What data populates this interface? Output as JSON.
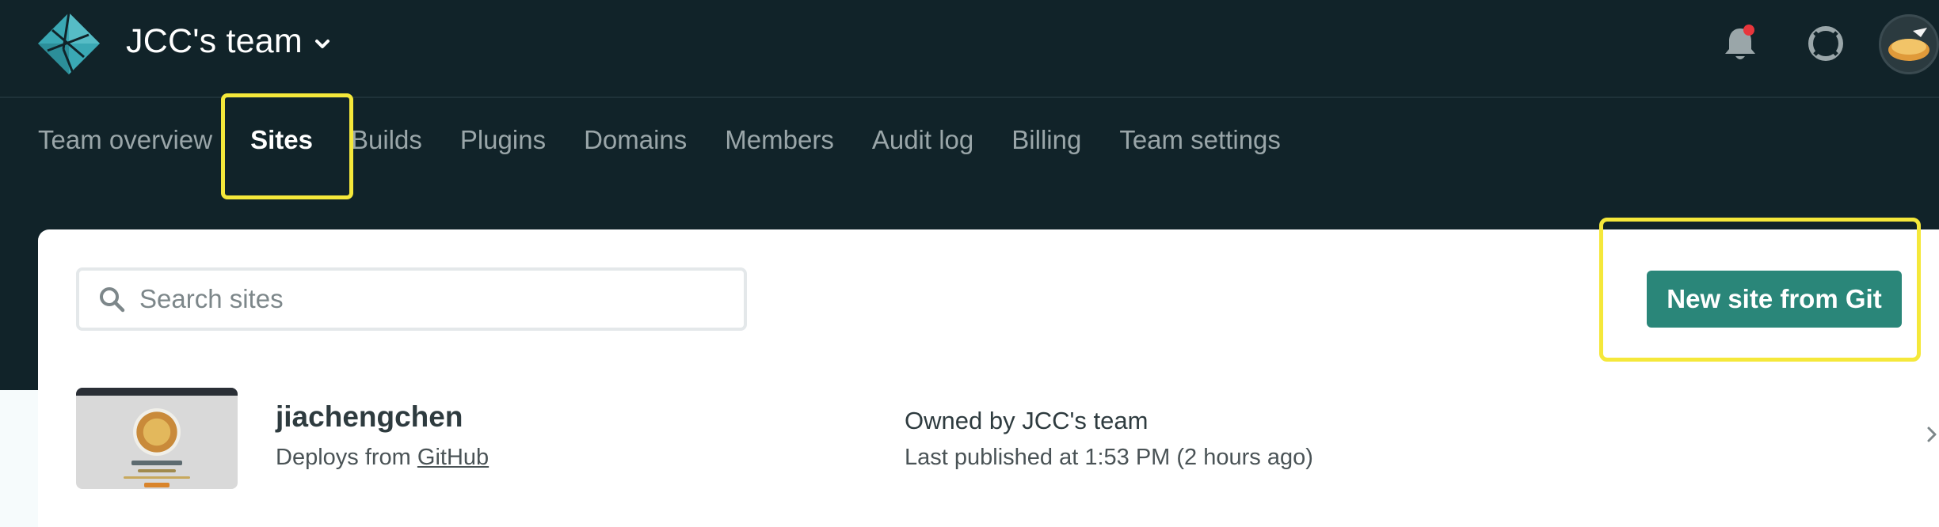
{
  "header": {
    "team_name": "JCC's team"
  },
  "icons": {
    "logo": "netlify-logo-icon",
    "caret": "chevron-down-icon",
    "notifications": "bell-icon",
    "help": "lifebuoy-icon",
    "avatar": "user-avatar"
  },
  "tabs": [
    {
      "label": "Team overview",
      "active": false
    },
    {
      "label": "Sites",
      "active": true
    },
    {
      "label": "Builds",
      "active": false
    },
    {
      "label": "Plugins",
      "active": false
    },
    {
      "label": "Domains",
      "active": false
    },
    {
      "label": "Members",
      "active": false
    },
    {
      "label": "Audit log",
      "active": false
    },
    {
      "label": "Billing",
      "active": false
    },
    {
      "label": "Team settings",
      "active": false
    }
  ],
  "search": {
    "placeholder": "Search sites",
    "value": ""
  },
  "actions": {
    "new_site_label": "New site from Git"
  },
  "sites": [
    {
      "name": "jiachengchen",
      "deploy_prefix": "Deploys from ",
      "deploy_source": "GitHub",
      "owner_prefix": "Owned by ",
      "owner": "JCC's team",
      "published": "Last published at 1:53 PM (2 hours ago)"
    }
  ],
  "colors": {
    "header_bg": "#112329",
    "accent": "#2a8679",
    "highlight": "#f5e83a",
    "notification_dot": "#e8363c"
  }
}
